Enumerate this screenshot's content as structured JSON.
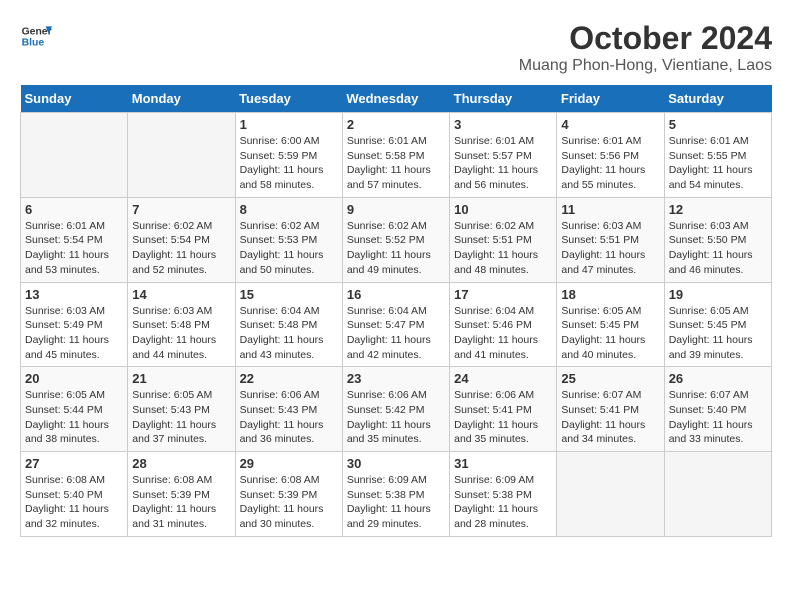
{
  "header": {
    "logo_line1": "General",
    "logo_line2": "Blue",
    "main_title": "October 2024",
    "subtitle": "Muang Phon-Hong, Vientiane, Laos"
  },
  "calendar": {
    "days_of_week": [
      "Sunday",
      "Monday",
      "Tuesday",
      "Wednesday",
      "Thursday",
      "Friday",
      "Saturday"
    ],
    "weeks": [
      [
        {
          "num": "",
          "detail": ""
        },
        {
          "num": "",
          "detail": ""
        },
        {
          "num": "1",
          "detail": "Sunrise: 6:00 AM\nSunset: 5:59 PM\nDaylight: 11 hours and 58 minutes."
        },
        {
          "num": "2",
          "detail": "Sunrise: 6:01 AM\nSunset: 5:58 PM\nDaylight: 11 hours and 57 minutes."
        },
        {
          "num": "3",
          "detail": "Sunrise: 6:01 AM\nSunset: 5:57 PM\nDaylight: 11 hours and 56 minutes."
        },
        {
          "num": "4",
          "detail": "Sunrise: 6:01 AM\nSunset: 5:56 PM\nDaylight: 11 hours and 55 minutes."
        },
        {
          "num": "5",
          "detail": "Sunrise: 6:01 AM\nSunset: 5:55 PM\nDaylight: 11 hours and 54 minutes."
        }
      ],
      [
        {
          "num": "6",
          "detail": "Sunrise: 6:01 AM\nSunset: 5:54 PM\nDaylight: 11 hours and 53 minutes."
        },
        {
          "num": "7",
          "detail": "Sunrise: 6:02 AM\nSunset: 5:54 PM\nDaylight: 11 hours and 52 minutes."
        },
        {
          "num": "8",
          "detail": "Sunrise: 6:02 AM\nSunset: 5:53 PM\nDaylight: 11 hours and 50 minutes."
        },
        {
          "num": "9",
          "detail": "Sunrise: 6:02 AM\nSunset: 5:52 PM\nDaylight: 11 hours and 49 minutes."
        },
        {
          "num": "10",
          "detail": "Sunrise: 6:02 AM\nSunset: 5:51 PM\nDaylight: 11 hours and 48 minutes."
        },
        {
          "num": "11",
          "detail": "Sunrise: 6:03 AM\nSunset: 5:51 PM\nDaylight: 11 hours and 47 minutes."
        },
        {
          "num": "12",
          "detail": "Sunrise: 6:03 AM\nSunset: 5:50 PM\nDaylight: 11 hours and 46 minutes."
        }
      ],
      [
        {
          "num": "13",
          "detail": "Sunrise: 6:03 AM\nSunset: 5:49 PM\nDaylight: 11 hours and 45 minutes."
        },
        {
          "num": "14",
          "detail": "Sunrise: 6:03 AM\nSunset: 5:48 PM\nDaylight: 11 hours and 44 minutes."
        },
        {
          "num": "15",
          "detail": "Sunrise: 6:04 AM\nSunset: 5:48 PM\nDaylight: 11 hours and 43 minutes."
        },
        {
          "num": "16",
          "detail": "Sunrise: 6:04 AM\nSunset: 5:47 PM\nDaylight: 11 hours and 42 minutes."
        },
        {
          "num": "17",
          "detail": "Sunrise: 6:04 AM\nSunset: 5:46 PM\nDaylight: 11 hours and 41 minutes."
        },
        {
          "num": "18",
          "detail": "Sunrise: 6:05 AM\nSunset: 5:45 PM\nDaylight: 11 hours and 40 minutes."
        },
        {
          "num": "19",
          "detail": "Sunrise: 6:05 AM\nSunset: 5:45 PM\nDaylight: 11 hours and 39 minutes."
        }
      ],
      [
        {
          "num": "20",
          "detail": "Sunrise: 6:05 AM\nSunset: 5:44 PM\nDaylight: 11 hours and 38 minutes."
        },
        {
          "num": "21",
          "detail": "Sunrise: 6:05 AM\nSunset: 5:43 PM\nDaylight: 11 hours and 37 minutes."
        },
        {
          "num": "22",
          "detail": "Sunrise: 6:06 AM\nSunset: 5:43 PM\nDaylight: 11 hours and 36 minutes."
        },
        {
          "num": "23",
          "detail": "Sunrise: 6:06 AM\nSunset: 5:42 PM\nDaylight: 11 hours and 35 minutes."
        },
        {
          "num": "24",
          "detail": "Sunrise: 6:06 AM\nSunset: 5:41 PM\nDaylight: 11 hours and 35 minutes."
        },
        {
          "num": "25",
          "detail": "Sunrise: 6:07 AM\nSunset: 5:41 PM\nDaylight: 11 hours and 34 minutes."
        },
        {
          "num": "26",
          "detail": "Sunrise: 6:07 AM\nSunset: 5:40 PM\nDaylight: 11 hours and 33 minutes."
        }
      ],
      [
        {
          "num": "27",
          "detail": "Sunrise: 6:08 AM\nSunset: 5:40 PM\nDaylight: 11 hours and 32 minutes."
        },
        {
          "num": "28",
          "detail": "Sunrise: 6:08 AM\nSunset: 5:39 PM\nDaylight: 11 hours and 31 minutes."
        },
        {
          "num": "29",
          "detail": "Sunrise: 6:08 AM\nSunset: 5:39 PM\nDaylight: 11 hours and 30 minutes."
        },
        {
          "num": "30",
          "detail": "Sunrise: 6:09 AM\nSunset: 5:38 PM\nDaylight: 11 hours and 29 minutes."
        },
        {
          "num": "31",
          "detail": "Sunrise: 6:09 AM\nSunset: 5:38 PM\nDaylight: 11 hours and 28 minutes."
        },
        {
          "num": "",
          "detail": ""
        },
        {
          "num": "",
          "detail": ""
        }
      ]
    ]
  }
}
